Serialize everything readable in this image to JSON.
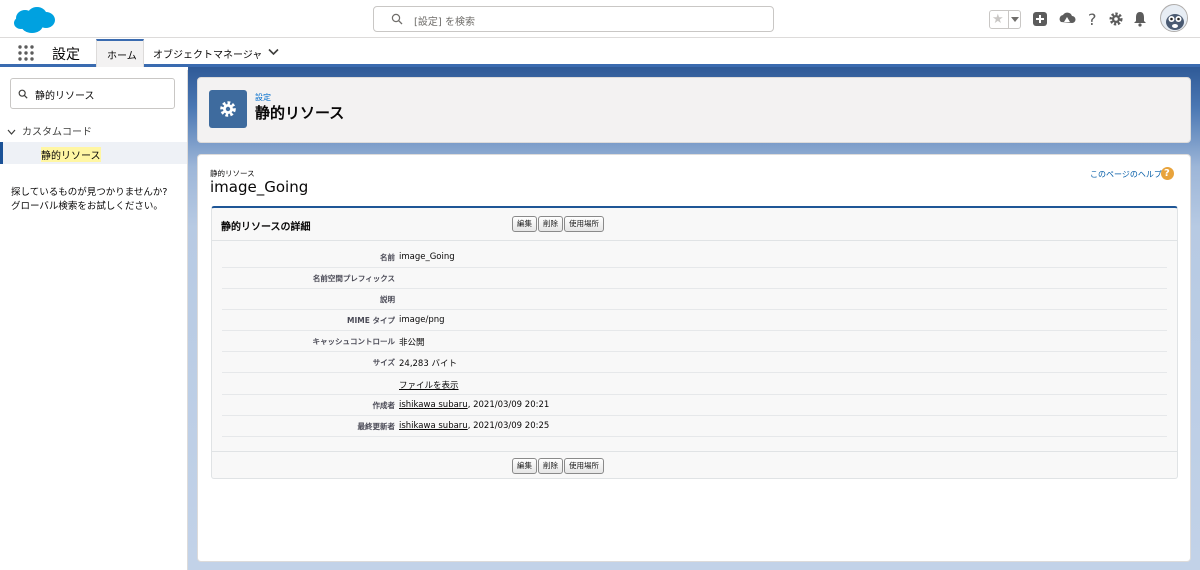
{
  "header": {
    "search_placeholder": "[設定] を検索"
  },
  "nav": {
    "app_name": "設定",
    "tabs": [
      {
        "label": "ホーム"
      },
      {
        "label": "オブジェクトマネージャ"
      }
    ]
  },
  "sidebar": {
    "quick_find_value": "静的リソース",
    "group_label": "カスタムコード",
    "selected_item": "静的リソース",
    "not_found_line1": "探しているものが見つかりませんか?",
    "not_found_line2": "グローバル検索をお試しください。"
  },
  "page_header": {
    "breadcrumb": "設定",
    "title": "静的リソース"
  },
  "record": {
    "type_label": "静的リソース",
    "name": "image_Going",
    "help_link": "このページのヘルプ",
    "help_icon_glyph": "?"
  },
  "detail": {
    "title": "静的リソースの詳細",
    "buttons": {
      "edit": "編集",
      "delete": "削除",
      "where_used": "使用場所"
    },
    "fields": {
      "name_label": "名前",
      "name_value": "image_Going",
      "namespace_label": "名前空間プレフィックス",
      "namespace_value": "",
      "description_label": "説明",
      "description_value": "",
      "mime_label": "MIME タイプ",
      "mime_value": "image/png",
      "cache_label": "キャッシュコントロール",
      "cache_value": "非公開",
      "size_label": "サイズ",
      "size_value": "24,283 バイト",
      "view_file_link": "ファイルを表示",
      "created_label": "作成者",
      "created_user": "ishikawa subaru",
      "created_date": ", 2021/03/09 20:21",
      "modified_label": "最終更新者",
      "modified_user": "ishikawa subaru",
      "modified_date": ", 2021/03/09 20:25"
    }
  },
  "colors": {
    "brand_blue": "#1b5297",
    "link_blue": "#015ba7",
    "setup_icon_bg": "#3e6b9e",
    "highlight": "#fff6a3"
  },
  "icons": [
    "salesforce-cloud-logo",
    "search-icon",
    "star-icon",
    "chevron-down-icon",
    "add-icon",
    "trailhead-icon",
    "help-icon",
    "gear-icon",
    "bell-icon",
    "avatar",
    "app-launcher-icon"
  ]
}
